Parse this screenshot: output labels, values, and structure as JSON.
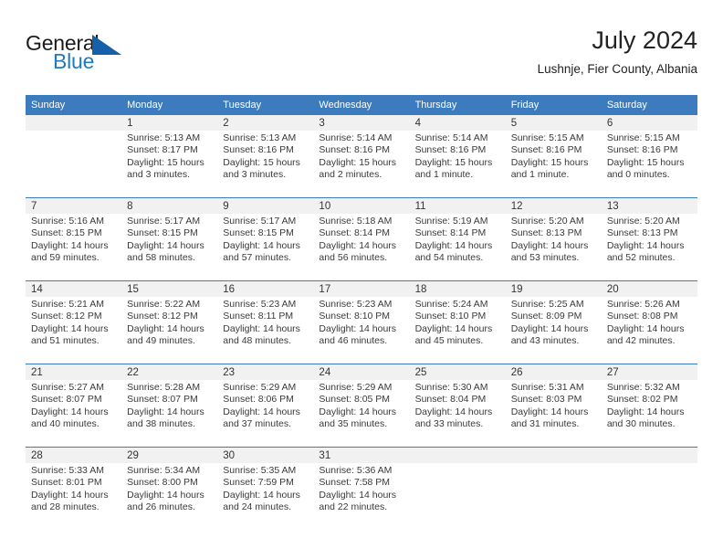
{
  "brand": {
    "name_part1": "General",
    "name_part2": "Blue",
    "triangle_color": "#1560a8",
    "blue_text_color": "#1f7ac4"
  },
  "header": {
    "title": "July 2024",
    "subtitle": "Lushnje, Fier County, Albania"
  },
  "theme": {
    "header_bar_color": "#3c7cbe",
    "daynum_band_color": "#f1f1f1",
    "separator_color": "#3c7cbe"
  },
  "columns": [
    "Sunday",
    "Monday",
    "Tuesday",
    "Wednesday",
    "Thursday",
    "Friday",
    "Saturday"
  ],
  "weeks": [
    {
      "days": [
        {
          "num": "",
          "sunrise": "",
          "sunset": "",
          "daylight_a": "",
          "daylight_b": ""
        },
        {
          "num": "1",
          "sunrise": "Sunrise: 5:13 AM",
          "sunset": "Sunset: 8:17 PM",
          "daylight_a": "Daylight: 15 hours",
          "daylight_b": "and 3 minutes."
        },
        {
          "num": "2",
          "sunrise": "Sunrise: 5:13 AM",
          "sunset": "Sunset: 8:16 PM",
          "daylight_a": "Daylight: 15 hours",
          "daylight_b": "and 3 minutes."
        },
        {
          "num": "3",
          "sunrise": "Sunrise: 5:14 AM",
          "sunset": "Sunset: 8:16 PM",
          "daylight_a": "Daylight: 15 hours",
          "daylight_b": "and 2 minutes."
        },
        {
          "num": "4",
          "sunrise": "Sunrise: 5:14 AM",
          "sunset": "Sunset: 8:16 PM",
          "daylight_a": "Daylight: 15 hours",
          "daylight_b": "and 1 minute."
        },
        {
          "num": "5",
          "sunrise": "Sunrise: 5:15 AM",
          "sunset": "Sunset: 8:16 PM",
          "daylight_a": "Daylight: 15 hours",
          "daylight_b": "and 1 minute."
        },
        {
          "num": "6",
          "sunrise": "Sunrise: 5:15 AM",
          "sunset": "Sunset: 8:16 PM",
          "daylight_a": "Daylight: 15 hours",
          "daylight_b": "and 0 minutes."
        }
      ]
    },
    {
      "days": [
        {
          "num": "7",
          "sunrise": "Sunrise: 5:16 AM",
          "sunset": "Sunset: 8:15 PM",
          "daylight_a": "Daylight: 14 hours",
          "daylight_b": "and 59 minutes."
        },
        {
          "num": "8",
          "sunrise": "Sunrise: 5:17 AM",
          "sunset": "Sunset: 8:15 PM",
          "daylight_a": "Daylight: 14 hours",
          "daylight_b": "and 58 minutes."
        },
        {
          "num": "9",
          "sunrise": "Sunrise: 5:17 AM",
          "sunset": "Sunset: 8:15 PM",
          "daylight_a": "Daylight: 14 hours",
          "daylight_b": "and 57 minutes."
        },
        {
          "num": "10",
          "sunrise": "Sunrise: 5:18 AM",
          "sunset": "Sunset: 8:14 PM",
          "daylight_a": "Daylight: 14 hours",
          "daylight_b": "and 56 minutes."
        },
        {
          "num": "11",
          "sunrise": "Sunrise: 5:19 AM",
          "sunset": "Sunset: 8:14 PM",
          "daylight_a": "Daylight: 14 hours",
          "daylight_b": "and 54 minutes."
        },
        {
          "num": "12",
          "sunrise": "Sunrise: 5:20 AM",
          "sunset": "Sunset: 8:13 PM",
          "daylight_a": "Daylight: 14 hours",
          "daylight_b": "and 53 minutes."
        },
        {
          "num": "13",
          "sunrise": "Sunrise: 5:20 AM",
          "sunset": "Sunset: 8:13 PM",
          "daylight_a": "Daylight: 14 hours",
          "daylight_b": "and 52 minutes."
        }
      ]
    },
    {
      "days": [
        {
          "num": "14",
          "sunrise": "Sunrise: 5:21 AM",
          "sunset": "Sunset: 8:12 PM",
          "daylight_a": "Daylight: 14 hours",
          "daylight_b": "and 51 minutes."
        },
        {
          "num": "15",
          "sunrise": "Sunrise: 5:22 AM",
          "sunset": "Sunset: 8:12 PM",
          "daylight_a": "Daylight: 14 hours",
          "daylight_b": "and 49 minutes."
        },
        {
          "num": "16",
          "sunrise": "Sunrise: 5:23 AM",
          "sunset": "Sunset: 8:11 PM",
          "daylight_a": "Daylight: 14 hours",
          "daylight_b": "and 48 minutes."
        },
        {
          "num": "17",
          "sunrise": "Sunrise: 5:23 AM",
          "sunset": "Sunset: 8:10 PM",
          "daylight_a": "Daylight: 14 hours",
          "daylight_b": "and 46 minutes."
        },
        {
          "num": "18",
          "sunrise": "Sunrise: 5:24 AM",
          "sunset": "Sunset: 8:10 PM",
          "daylight_a": "Daylight: 14 hours",
          "daylight_b": "and 45 minutes."
        },
        {
          "num": "19",
          "sunrise": "Sunrise: 5:25 AM",
          "sunset": "Sunset: 8:09 PM",
          "daylight_a": "Daylight: 14 hours",
          "daylight_b": "and 43 minutes."
        },
        {
          "num": "20",
          "sunrise": "Sunrise: 5:26 AM",
          "sunset": "Sunset: 8:08 PM",
          "daylight_a": "Daylight: 14 hours",
          "daylight_b": "and 42 minutes."
        }
      ]
    },
    {
      "days": [
        {
          "num": "21",
          "sunrise": "Sunrise: 5:27 AM",
          "sunset": "Sunset: 8:07 PM",
          "daylight_a": "Daylight: 14 hours",
          "daylight_b": "and 40 minutes."
        },
        {
          "num": "22",
          "sunrise": "Sunrise: 5:28 AM",
          "sunset": "Sunset: 8:07 PM",
          "daylight_a": "Daylight: 14 hours",
          "daylight_b": "and 38 minutes."
        },
        {
          "num": "23",
          "sunrise": "Sunrise: 5:29 AM",
          "sunset": "Sunset: 8:06 PM",
          "daylight_a": "Daylight: 14 hours",
          "daylight_b": "and 37 minutes."
        },
        {
          "num": "24",
          "sunrise": "Sunrise: 5:29 AM",
          "sunset": "Sunset: 8:05 PM",
          "daylight_a": "Daylight: 14 hours",
          "daylight_b": "and 35 minutes."
        },
        {
          "num": "25",
          "sunrise": "Sunrise: 5:30 AM",
          "sunset": "Sunset: 8:04 PM",
          "daylight_a": "Daylight: 14 hours",
          "daylight_b": "and 33 minutes."
        },
        {
          "num": "26",
          "sunrise": "Sunrise: 5:31 AM",
          "sunset": "Sunset: 8:03 PM",
          "daylight_a": "Daylight: 14 hours",
          "daylight_b": "and 31 minutes."
        },
        {
          "num": "27",
          "sunrise": "Sunrise: 5:32 AM",
          "sunset": "Sunset: 8:02 PM",
          "daylight_a": "Daylight: 14 hours",
          "daylight_b": "and 30 minutes."
        }
      ]
    },
    {
      "days": [
        {
          "num": "28",
          "sunrise": "Sunrise: 5:33 AM",
          "sunset": "Sunset: 8:01 PM",
          "daylight_a": "Daylight: 14 hours",
          "daylight_b": "and 28 minutes."
        },
        {
          "num": "29",
          "sunrise": "Sunrise: 5:34 AM",
          "sunset": "Sunset: 8:00 PM",
          "daylight_a": "Daylight: 14 hours",
          "daylight_b": "and 26 minutes."
        },
        {
          "num": "30",
          "sunrise": "Sunrise: 5:35 AM",
          "sunset": "Sunset: 7:59 PM",
          "daylight_a": "Daylight: 14 hours",
          "daylight_b": "and 24 minutes."
        },
        {
          "num": "31",
          "sunrise": "Sunrise: 5:36 AM",
          "sunset": "Sunset: 7:58 PM",
          "daylight_a": "Daylight: 14 hours",
          "daylight_b": "and 22 minutes."
        },
        {
          "num": "",
          "sunrise": "",
          "sunset": "",
          "daylight_a": "",
          "daylight_b": ""
        },
        {
          "num": "",
          "sunrise": "",
          "sunset": "",
          "daylight_a": "",
          "daylight_b": ""
        },
        {
          "num": "",
          "sunrise": "",
          "sunset": "",
          "daylight_a": "",
          "daylight_b": ""
        }
      ]
    }
  ]
}
